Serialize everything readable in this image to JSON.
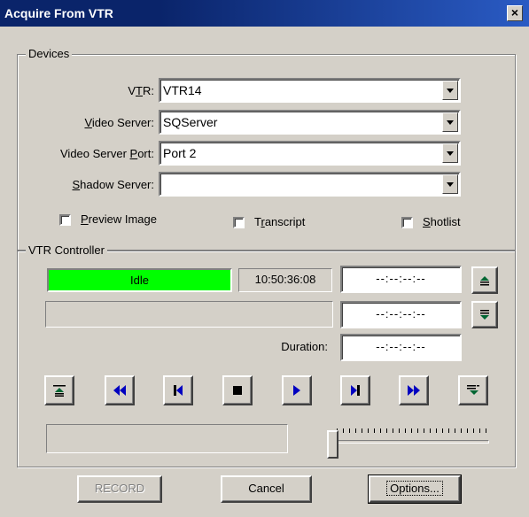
{
  "window": {
    "title": "Acquire From VTR",
    "close_glyph": "×"
  },
  "devices": {
    "group_title": "Devices",
    "vtr_label": "VTR:",
    "vtr_value": "VTR14",
    "video_server_label": "Video Server:",
    "video_server_value": "SQServer",
    "video_server_port_label": "Video Server Port:",
    "video_server_port_value": "Port 2",
    "shadow_server_label": "Shadow Server:",
    "shadow_server_value": ""
  },
  "options": {
    "preview_image_label": "Preview Image",
    "transcript_label": "Transcript",
    "shotlist_label": "Shotlist"
  },
  "vtr_controller": {
    "group_title": "VTR Controller",
    "status": "Idle",
    "status_color": "#00ff00",
    "timecode": "10:50:36:08",
    "mark_in": "--:--:--:--",
    "mark_out": "--:--:--:--",
    "duration_label": "Duration:",
    "duration": "--:--:--:--"
  },
  "transport_icons": [
    "eject-in-icon",
    "rewind-icon",
    "previous-frame-icon",
    "stop-icon",
    "play-icon",
    "next-frame-icon",
    "fast-forward-icon",
    "eject-out-icon"
  ],
  "buttons": {
    "record": "RECORD",
    "cancel": "Cancel",
    "options": "Options..."
  }
}
